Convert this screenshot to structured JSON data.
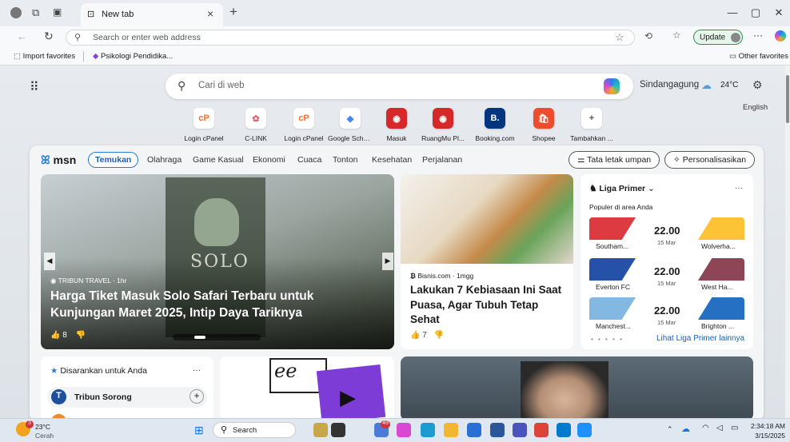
{
  "browser": {
    "tab_title": "New tab",
    "tab_close": "×",
    "new_tab": "+",
    "address_placeholder": "Search or enter web address",
    "update_label": "Update",
    "more": "···",
    "win_minimize": "—",
    "win_restore": "▢",
    "win_close": "✕"
  },
  "favorites": {
    "import": "Import favorites",
    "item1": "Psikologi Pendidika...",
    "other": "Other favorites"
  },
  "ntp": {
    "search_placeholder": "Cari di web",
    "location": "Sindangagung",
    "temperature": "24°C",
    "language": "English",
    "tiles": [
      {
        "label": "Login cPanel",
        "glyph": "cP",
        "color": "#ff6c2c"
      },
      {
        "label": "C-LINK",
        "glyph": "✿",
        "color": "#e5606a"
      },
      {
        "label": "Login cPanel",
        "glyph": "cP",
        "color": "#ff6c2c"
      },
      {
        "label": "Google Scho...",
        "glyph": "◆",
        "color": "#4285f4"
      },
      {
        "label": "Masuk",
        "glyph": "◉",
        "color": "#d62828"
      },
      {
        "label": "RuangMu Pl...",
        "glyph": "◉",
        "color": "#d62828"
      },
      {
        "label": "Booking.com",
        "glyph": "B.",
        "color": "#ffffff"
      },
      {
        "label": "Shopee",
        "glyph": "🛍",
        "color": "#ffffff"
      },
      {
        "label": "Tambahkan ...",
        "glyph": "+",
        "color": "#555555"
      }
    ]
  },
  "msn": {
    "logo": "msn",
    "nav": [
      "Temukan",
      "Olahraga",
      "Game Kasual",
      "Ekonomi",
      "Cuaca",
      "Tonton",
      "Kesehatan",
      "Perjalanan"
    ],
    "layout_btn": "Tata letak umpan",
    "personalize_btn": "Personalisasikan",
    "hero": {
      "source": "TRIBUN TRAVEL · 1hr",
      "headline": "Harga Tiket Masuk Solo Safari Terbaru untuk Kunjungan Maret 2025, Intip Daya Tariknya",
      "likes": "8",
      "sign": "SOLO"
    },
    "card2": {
      "source": "Bisnis.com · 1mgg",
      "headline": "Lakukan 7 Kebiasaan Ini Saat Puasa, Agar Tubuh Tetap Sehat",
      "likes": "7"
    },
    "league": {
      "title": "Liga Primer",
      "subtitle": "Populer di area Anda",
      "more_link": "Lihat Liga Primer lainnya",
      "matches": [
        {
          "home": "Southam...",
          "away": "Wolverha...",
          "time": "22.00",
          "date": "15 Mar",
          "home_color": "#d71920",
          "away_color": "#fdb913"
        },
        {
          "home": "Everton FC",
          "away": "West Ha...",
          "time": "22.00",
          "date": "15 Mar",
          "home_color": "#003399",
          "away_color": "#7a263a"
        },
        {
          "home": "Manchest...",
          "away": "Brighton ...",
          "time": "22.00",
          "date": "15 Mar",
          "home_color": "#6cabdd",
          "away_color": "#0057b8"
        }
      ]
    },
    "suggested": {
      "title": "Disarankan untuk Anda",
      "item1": "Tribun Sorong"
    }
  },
  "taskbar": {
    "weather_temp": "23°C",
    "weather_desc": "Cerah",
    "search": "Search",
    "time": "2:34:18 AM",
    "date": "3/15/2025",
    "chat_badge": "49"
  }
}
